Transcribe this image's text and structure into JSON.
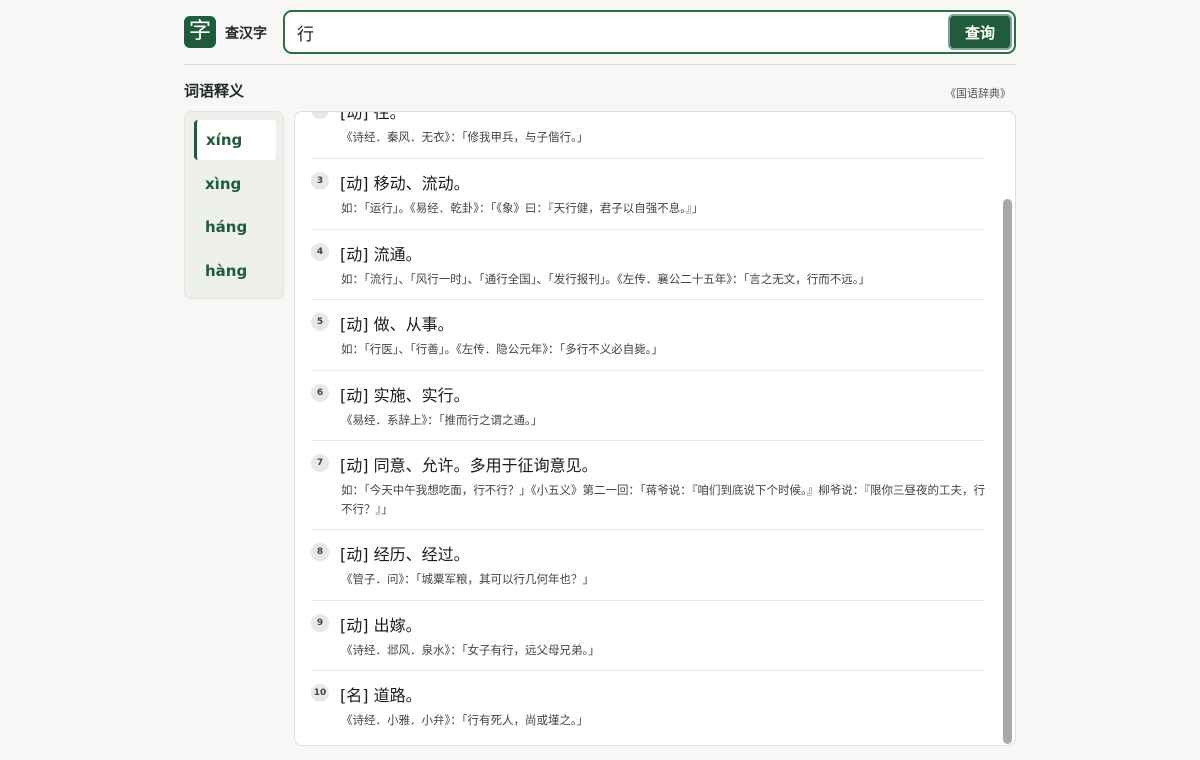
{
  "header": {
    "logo_char": "字",
    "app_name": "查汉字",
    "search_value": "行",
    "search_button": "查询"
  },
  "section": {
    "title": "词语释义",
    "source": "《国语辞典》"
  },
  "pinyin": [
    {
      "label": "xíng",
      "active": true
    },
    {
      "label": "xìng",
      "active": false
    },
    {
      "label": "háng",
      "active": false
    },
    {
      "label": "hàng",
      "active": false
    }
  ],
  "definitions": [
    {
      "num": "",
      "text": "[动] 往。",
      "example": "《诗经．秦风．无衣》：「修我甲兵，与子偕行。」"
    },
    {
      "num": "3",
      "text": "[动] 移动、流动。",
      "example": "如：「运行」。《易经．乾卦》：「《象》曰：『天行健，君子以自强不息。』」"
    },
    {
      "num": "4",
      "text": "[动] 流通。",
      "example": "如：「流行」、「风行一时」、「通行全国」、「发行报刊」。《左传．襄公二十五年》：「言之无文，行而不远。」"
    },
    {
      "num": "5",
      "text": "[动] 做、从事。",
      "example": "如：「行医」、「行善」。《左传．隐公元年》：「多行不义必自毙。」"
    },
    {
      "num": "6",
      "text": "[动] 实施、实行。",
      "example": "《易经．系辞上》：「推而行之谓之通。」"
    },
    {
      "num": "7",
      "text": "[动] 同意、允许。多用于征询意见。",
      "example": "如：「今天中午我想吃面，行不行？」《小五义》第二一回：「蒋爷说：『咱们到底说下个时候。』柳爷说：『限你三昼夜的工夫，行不行？』」"
    },
    {
      "num": "8",
      "text": "[动] 经历、经过。",
      "example": "《管子．问》：「城粟军粮，其可以行几何年也？」"
    },
    {
      "num": "9",
      "text": "[动] 出嫁。",
      "example": "《诗经．邶风．泉水》：「女子有行，远父母兄弟。」"
    },
    {
      "num": "10",
      "text": "[名] 道路。",
      "example": "《诗经．小雅．小弁》：「行有死人，尚或墐之。」"
    }
  ],
  "colors": {
    "accent": "#1f5b3c",
    "panel_bg": "#eef0ec",
    "page_bg": "#f7f7f5"
  }
}
